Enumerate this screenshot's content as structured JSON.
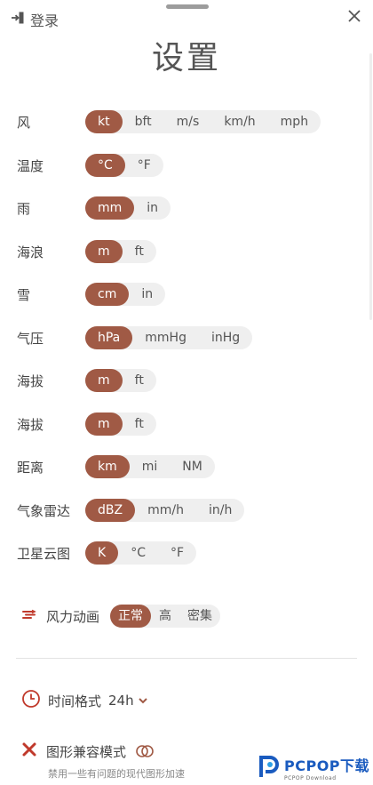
{
  "header": {
    "login_label": "登录",
    "title": "设置"
  },
  "units": [
    {
      "label": "风",
      "options": [
        "kt",
        "bft",
        "m/s",
        "km/h",
        "mph"
      ],
      "selected": 0
    },
    {
      "label": "温度",
      "options": [
        "°C",
        "°F"
      ],
      "selected": 0
    },
    {
      "label": "雨",
      "options": [
        "mm",
        "in"
      ],
      "selected": 0
    },
    {
      "label": "海浪",
      "options": [
        "m",
        "ft"
      ],
      "selected": 0
    },
    {
      "label": "雪",
      "options": [
        "cm",
        "in"
      ],
      "selected": 0
    },
    {
      "label": "气压",
      "options": [
        "hPa",
        "mmHg",
        "inHg"
      ],
      "selected": 0
    },
    {
      "label": "海拔",
      "options": [
        "m",
        "ft"
      ],
      "selected": 0
    },
    {
      "label": "海拔",
      "options": [
        "m",
        "ft"
      ],
      "selected": 0
    },
    {
      "label": "距离",
      "options": [
        "km",
        "mi",
        "NM"
      ],
      "selected": 0
    },
    {
      "label": "气象雷达",
      "options": [
        "dBZ",
        "mm/h",
        "in/h"
      ],
      "selected": 0
    },
    {
      "label": "卫星云图",
      "options": [
        "K",
        "°C",
        "°F"
      ],
      "selected": 0
    }
  ],
  "wind_animation": {
    "label": "风力动画",
    "options": [
      "正常",
      "高",
      "密集"
    ],
    "selected": 0
  },
  "time_format": {
    "label": "时间格式",
    "value": "24h"
  },
  "graphics_compat": {
    "label": "图形兼容模式",
    "description": "禁用一些有问题的现代图形加速"
  },
  "watermark": {
    "main": "PCPOP下载",
    "sub": "PCPOP Download"
  },
  "colors": {
    "accent": "#a05a45",
    "danger": "#c0392b",
    "pill_bg": "#efefef"
  }
}
